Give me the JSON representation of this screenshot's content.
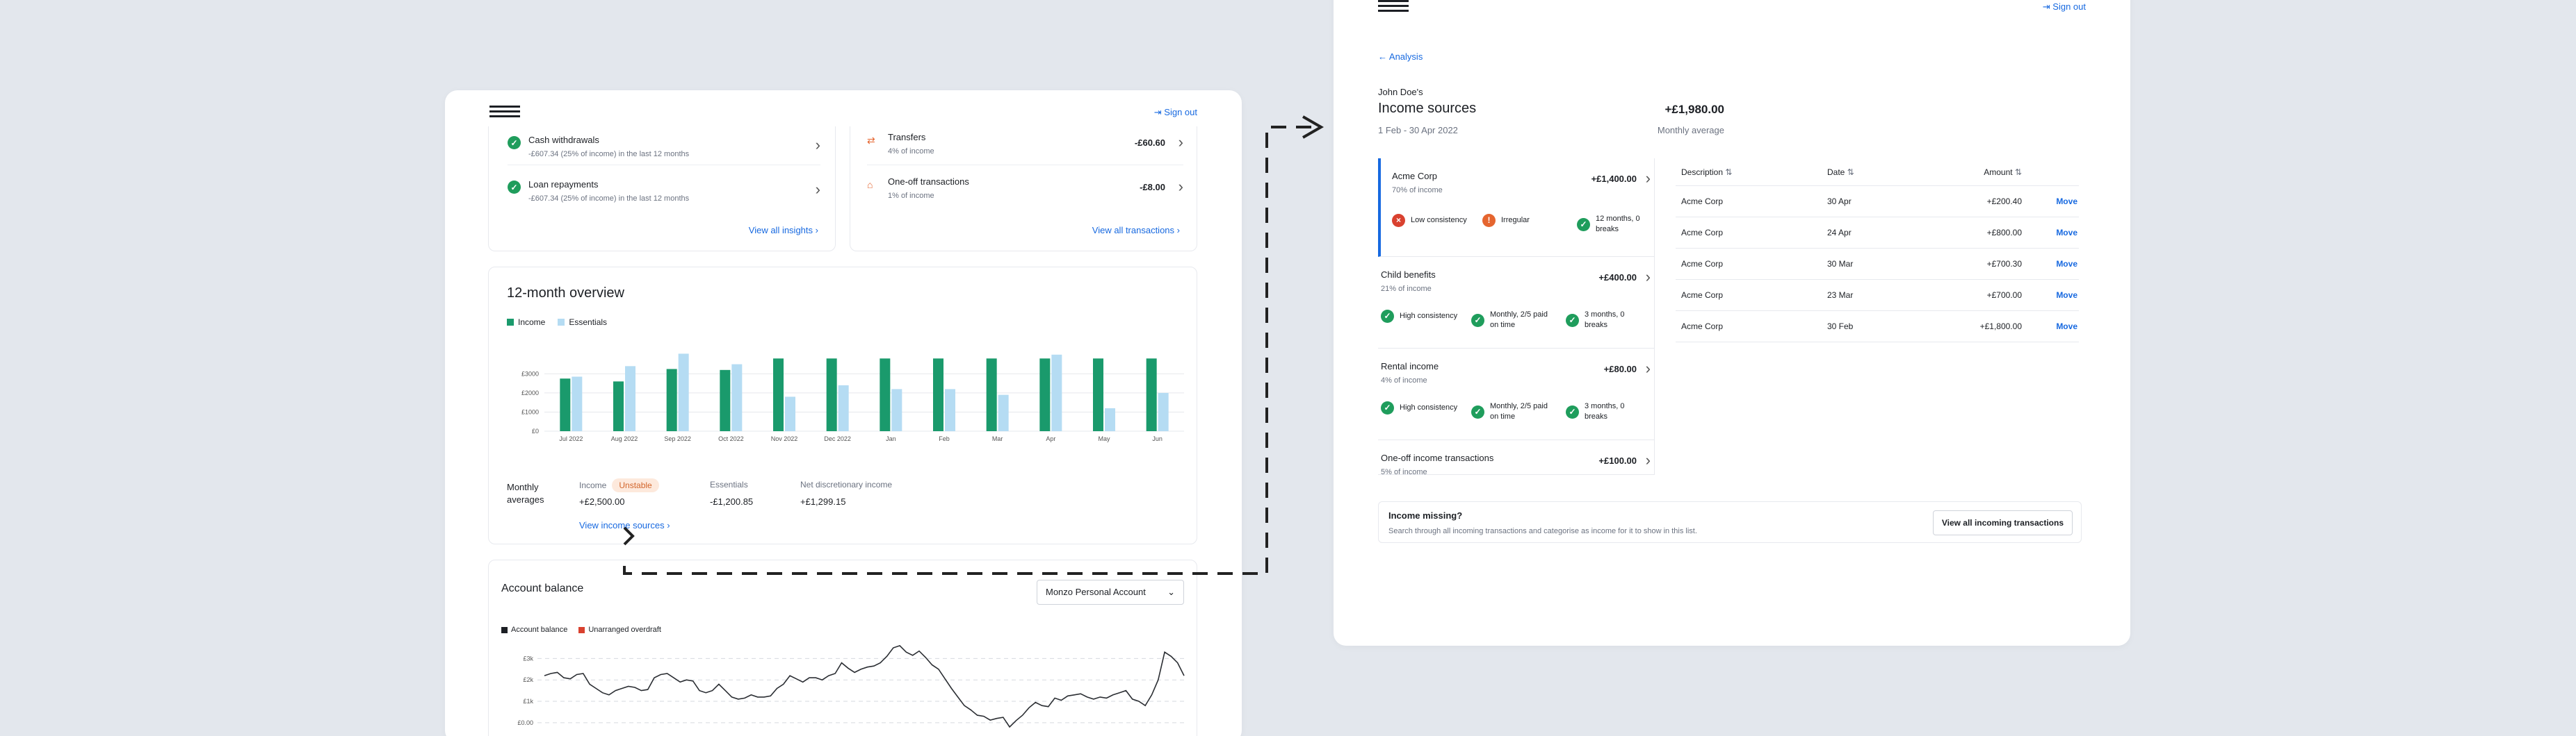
{
  "left": {
    "sign_out": "Sign out",
    "insights": [
      {
        "title": "Cash withdrawals",
        "desc": "-£607.34 (25% of income) in the last 12 months"
      },
      {
        "title": "Loan repayments",
        "desc": "-£607.34 (25% of income) in the last 12 months"
      }
    ],
    "view_all_insights": "View all insights",
    "transactions": [
      {
        "title": "Transfers",
        "sub": "4% of income",
        "amount": "-£60.60"
      },
      {
        "title": "One-off transactions",
        "sub": "1% of income",
        "amount": "-£8.00"
      }
    ],
    "view_all_transactions": "View all transactions",
    "overview": {
      "title": "12-month overview",
      "legend_income": "Income",
      "legend_essentials": "Essentials",
      "monthly_label": "Monthly averages",
      "income_label": "Income",
      "unstable": "Unstable",
      "income_value": "+£2,500.00",
      "essentials_label": "Essentials",
      "essentials_value": "-£1,200.85",
      "net_label": "Net discretionary income",
      "net_value": "+£1,299.15",
      "view_income_sources": "View income sources"
    },
    "balance": {
      "title": "Account balance",
      "account_select": "Monzo Personal Account",
      "legend_balance": "Account balance",
      "legend_overdraft": "Unarranged overdraft"
    }
  },
  "right": {
    "sign_out": "Sign out",
    "back": "Analysis",
    "owner": "John Doe's",
    "title": "Income sources",
    "period": "1 Feb - 30 Apr 2022",
    "avg_value": "+£1,980.00",
    "avg_label": "Monthly average",
    "sources": [
      {
        "name": "Acme Corp",
        "pct": "70% of income",
        "amount": "+£1,400.00",
        "tags": [
          {
            "kind": "bad",
            "text": "Low consistency"
          },
          {
            "kind": "warn",
            "text": "Irregular"
          },
          {
            "kind": "ok",
            "text": "12 months, 0 breaks"
          }
        ]
      },
      {
        "name": "Child benefits",
        "pct": "21% of income",
        "amount": "+£400.00",
        "tags": [
          {
            "kind": "ok",
            "text": "High consistency"
          },
          {
            "kind": "ok",
            "text": "Monthly, 2/5 paid on time"
          },
          {
            "kind": "ok",
            "text": "3 months, 0 breaks"
          }
        ]
      },
      {
        "name": "Rental income",
        "pct": "4% of income",
        "amount": "+£80.00",
        "tags": [
          {
            "kind": "ok",
            "text": "High consistency"
          },
          {
            "kind": "ok",
            "text": "Monthly, 2/5 paid on time"
          },
          {
            "kind": "ok",
            "text": "3 months, 0 breaks"
          }
        ]
      },
      {
        "name": "One-off income transactions",
        "pct": "5% of income",
        "amount": "+£100.00",
        "tags": []
      }
    ],
    "table": {
      "headers": [
        "Description",
        "Date",
        "Amount"
      ],
      "move_label": "Move",
      "rows": [
        {
          "desc": "Acme Corp",
          "date": "30 Apr",
          "amount": "+£200.40"
        },
        {
          "desc": "Acme Corp",
          "date": "24 Apr",
          "amount": "+£800.00"
        },
        {
          "desc": "Acme Corp",
          "date": "30 Mar",
          "amount": "+£700.30"
        },
        {
          "desc": "Acme Corp",
          "date": "23 Mar",
          "amount": "+£700.00"
        },
        {
          "desc": "Acme Corp",
          "date": "30 Feb",
          "amount": "+£1,800.00"
        }
      ]
    },
    "missing": {
      "title": "Income missing?",
      "desc": "Search through all incoming transactions and categorise as income for it to show in this list.",
      "button": "View all incoming transactions"
    }
  },
  "colors": {
    "income": "#1a9a6c",
    "essentials": "#b5dcf3",
    "link": "#1769e0",
    "accent_bar": "#1769e0",
    "overdraft": "#d9412f"
  },
  "chart_data": [
    {
      "type": "bar",
      "title": "12-month overview",
      "categories": [
        "Jul 2022",
        "Aug 2022",
        "Sep 2022",
        "Oct 2022",
        "Nov 2022",
        "Dec 2022",
        "Jan",
        "Feb",
        "Mar",
        "Apr",
        "May",
        "Jun"
      ],
      "series": [
        {
          "name": "Income",
          "values": [
            2750,
            2600,
            3250,
            3200,
            3800,
            3800,
            3800,
            3800,
            3800,
            3800,
            3800,
            3800
          ]
        },
        {
          "name": "Essentials",
          "values": [
            2850,
            3400,
            4050,
            3500,
            1800,
            2400,
            2200,
            2200,
            1900,
            4000,
            1200,
            2000
          ]
        }
      ],
      "yticks": [
        "£0",
        "£1000",
        "£2000",
        "£3000"
      ],
      "ylim": [
        0,
        4500
      ],
      "legend": "top-left",
      "grid": true
    },
    {
      "type": "line",
      "title": "Account balance",
      "series": [
        {
          "name": "Account balance",
          "values": [
            2200,
            2300,
            2350,
            2100,
            2050,
            2250,
            2300,
            1800,
            1600,
            1400,
            1300,
            1500,
            1600,
            1700,
            1650,
            1500,
            1550,
            2100,
            2250,
            2300,
            2100,
            1900,
            2000,
            1950,
            1500,
            1400,
            1500,
            1800,
            1500,
            1200,
            1100,
            1150,
            1300,
            1200,
            1200,
            1250,
            1600,
            1800,
            2200,
            2050,
            1900,
            2100,
            2100,
            2000,
            2200,
            2300,
            2800,
            2550,
            2350,
            2500,
            2600,
            2650,
            2800,
            3100,
            3500,
            3600,
            3300,
            3150,
            3350,
            3050,
            2700,
            2500,
            2050,
            1600,
            1200,
            800,
            600,
            350,
            300,
            120,
            200,
            250,
            -200,
            100,
            350,
            700,
            950,
            800,
            750,
            1150,
            1050,
            1250,
            1300,
            1350,
            1200,
            1100,
            1200,
            1150,
            1300,
            1400,
            1500,
            1100,
            1000,
            800,
            1300,
            2000,
            3300,
            3100,
            2800,
            2200
          ]
        }
      ],
      "yticks": [
        "£0.00",
        "£1k",
        "£2k",
        "£3k"
      ],
      "ylim": [
        -200,
        3500
      ],
      "grid": true
    }
  ]
}
